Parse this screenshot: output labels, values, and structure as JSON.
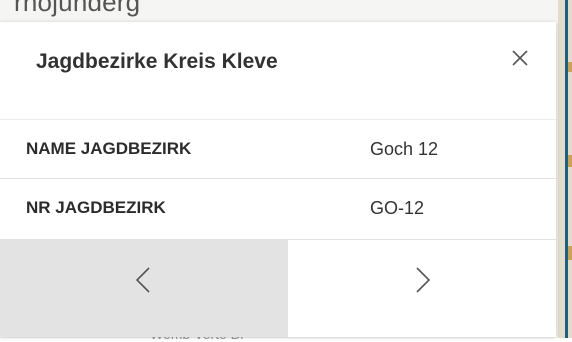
{
  "backdrop": {
    "top_text": "rhojunderg",
    "bottom_text": "Wemb  Verte  Bf"
  },
  "popup": {
    "title": "Jagdbezirke Kreis Kleve",
    "close_icon": "close-icon",
    "attributes": [
      {
        "name": "NAME JAGDBEZIRK",
        "value": "Goch 12"
      },
      {
        "name": "NR JAGDBEZIRK",
        "value": "GO-12"
      }
    ],
    "nav": {
      "prev_icon": "chevron-left-icon",
      "next_icon": "chevron-right-icon"
    }
  },
  "colors": {
    "title": "#323232",
    "prev_bg": "#e3e3e3",
    "map_edge": "#1f5f7a",
    "map_strip": "#e3dccd"
  }
}
